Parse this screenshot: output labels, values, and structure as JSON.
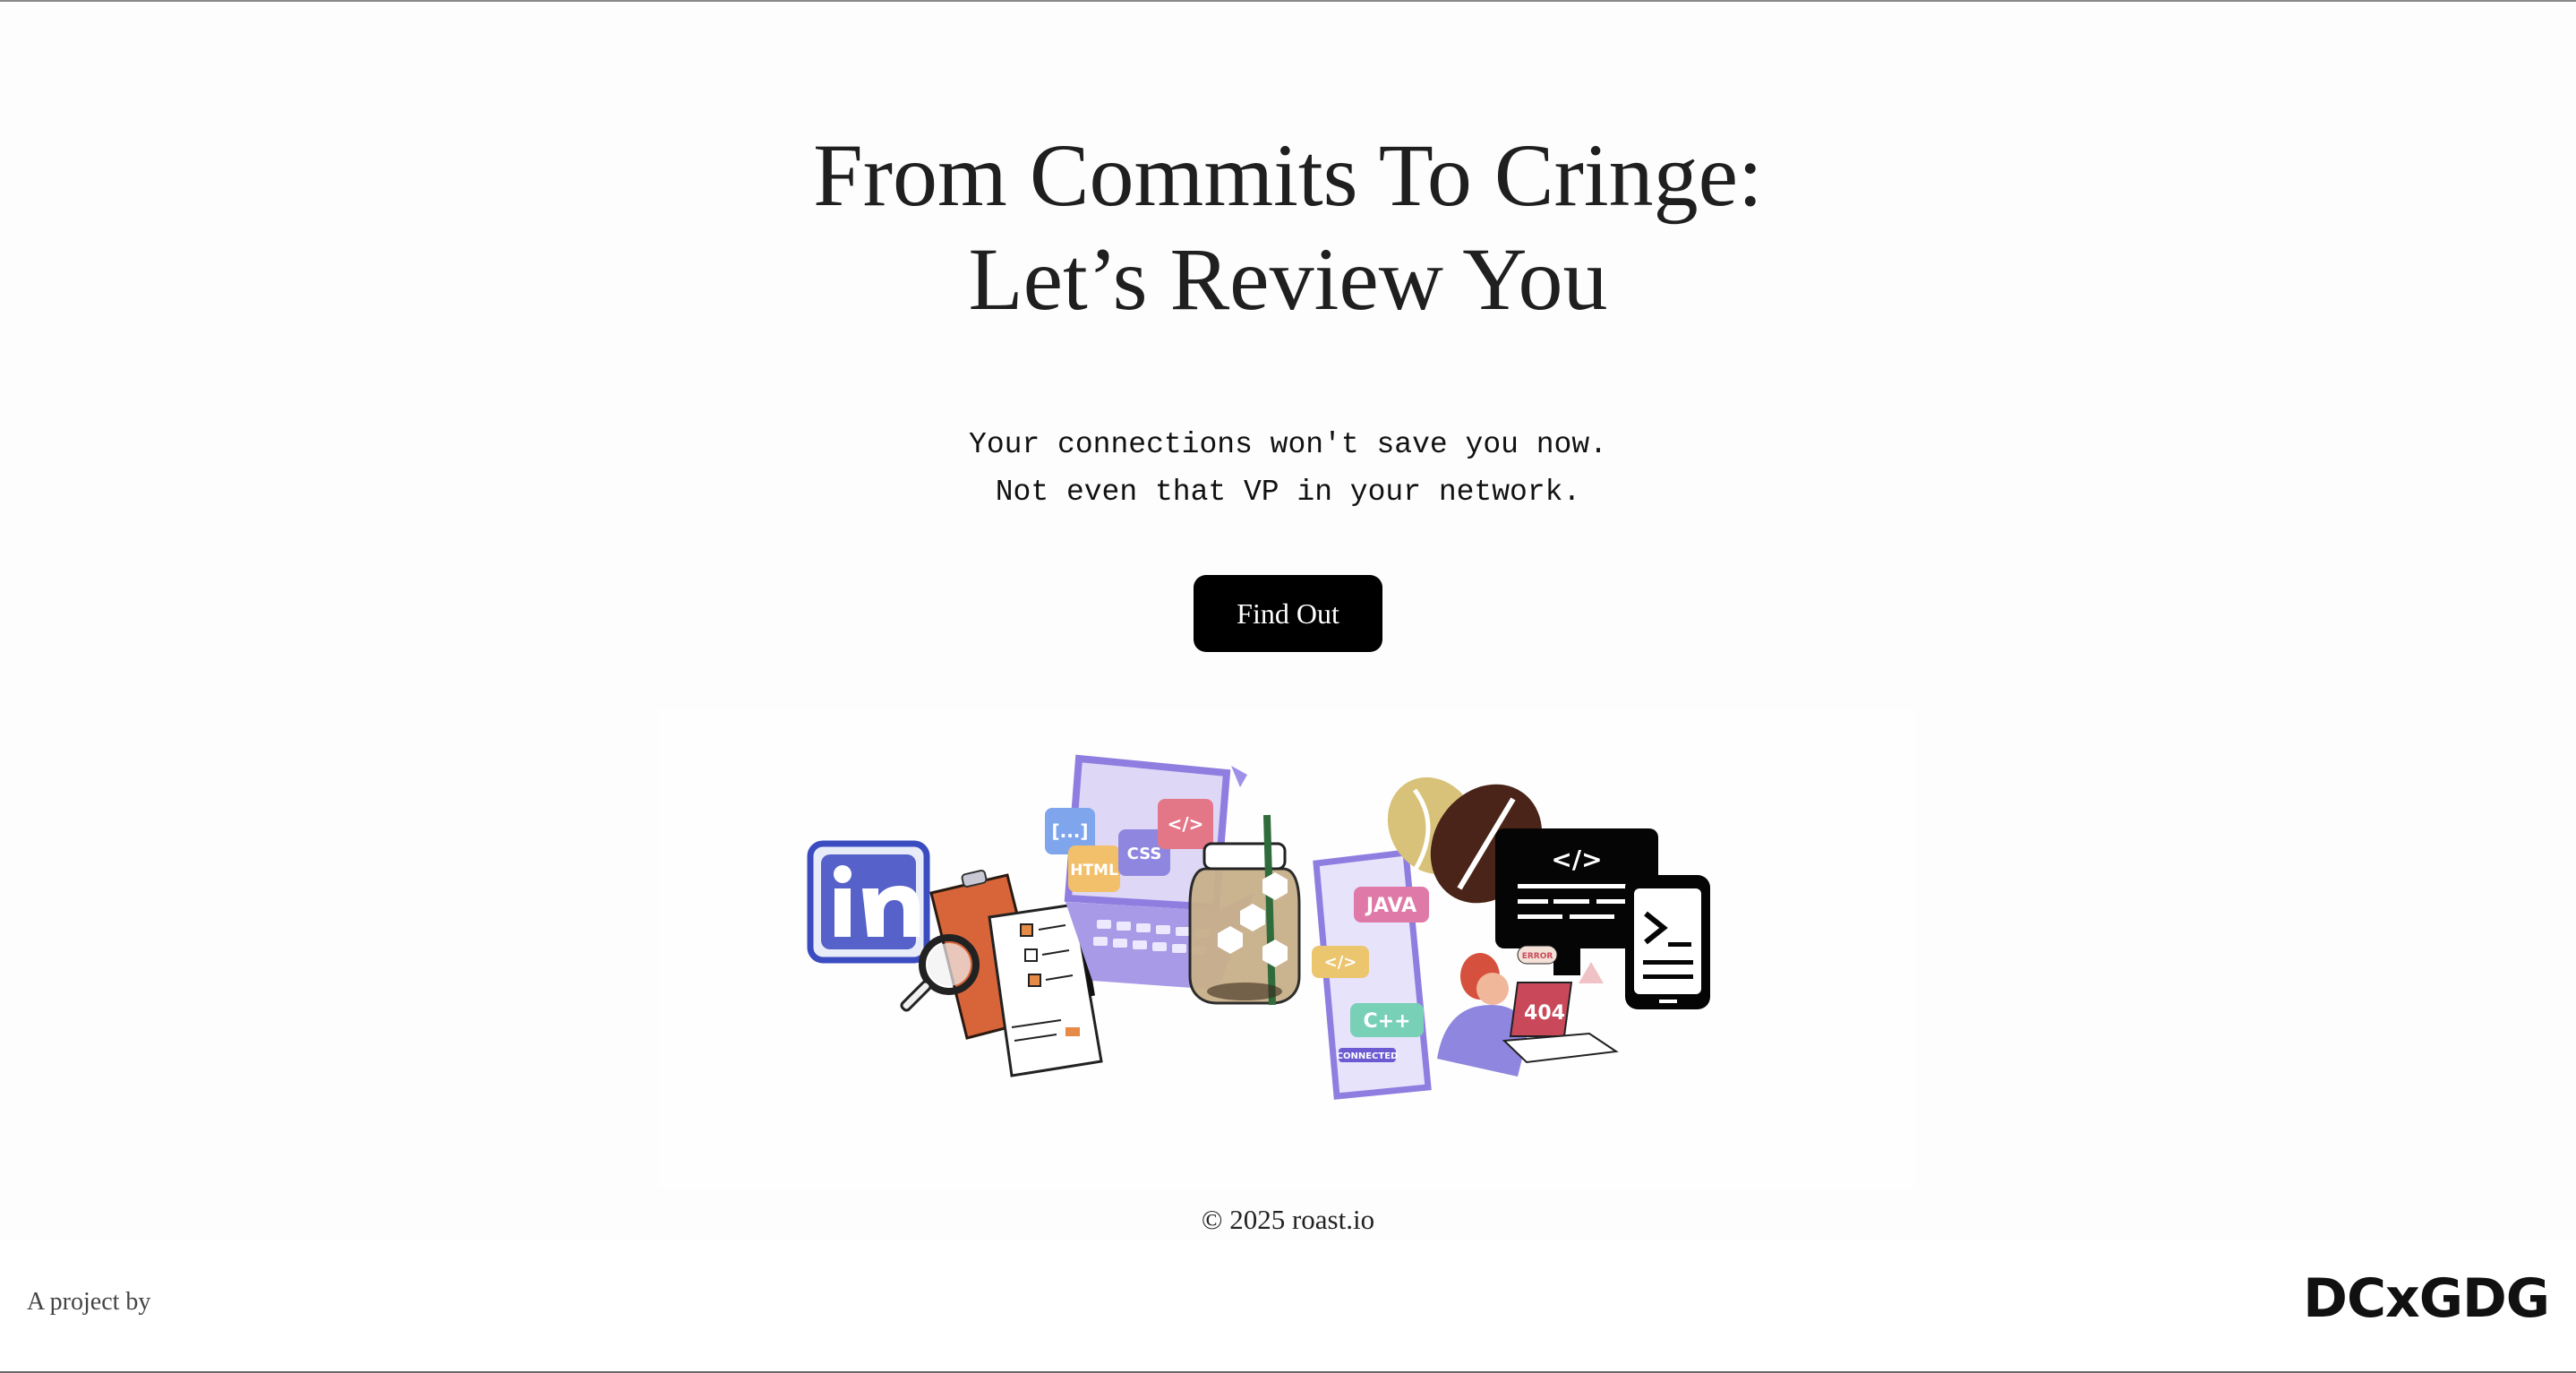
{
  "hero": {
    "title_line1": "From Commits To Cringe:",
    "title_line2": "Let’s Review You",
    "subtitle_line1": "Your connections won't save you now.",
    "subtitle_line2": "Not even that VP in your network.",
    "cta_label": "Find Out"
  },
  "illustration": {
    "labels": {
      "brackets": "[...]",
      "html": "HTML",
      "css": "CSS",
      "code_tag": "</>",
      "java": "JAVA",
      "cpp": "C++",
      "connected": "CONNECTED",
      "error": "ERROR",
      "not_found": "404",
      "prompt": ">_"
    }
  },
  "footer": {
    "copyright": "© 2025 roast.io",
    "project_by": "A project by",
    "logo": "DCxGDG"
  },
  "colors": {
    "button_bg": "#000000",
    "button_text": "#ffffff",
    "text": "#1f1f1f"
  }
}
